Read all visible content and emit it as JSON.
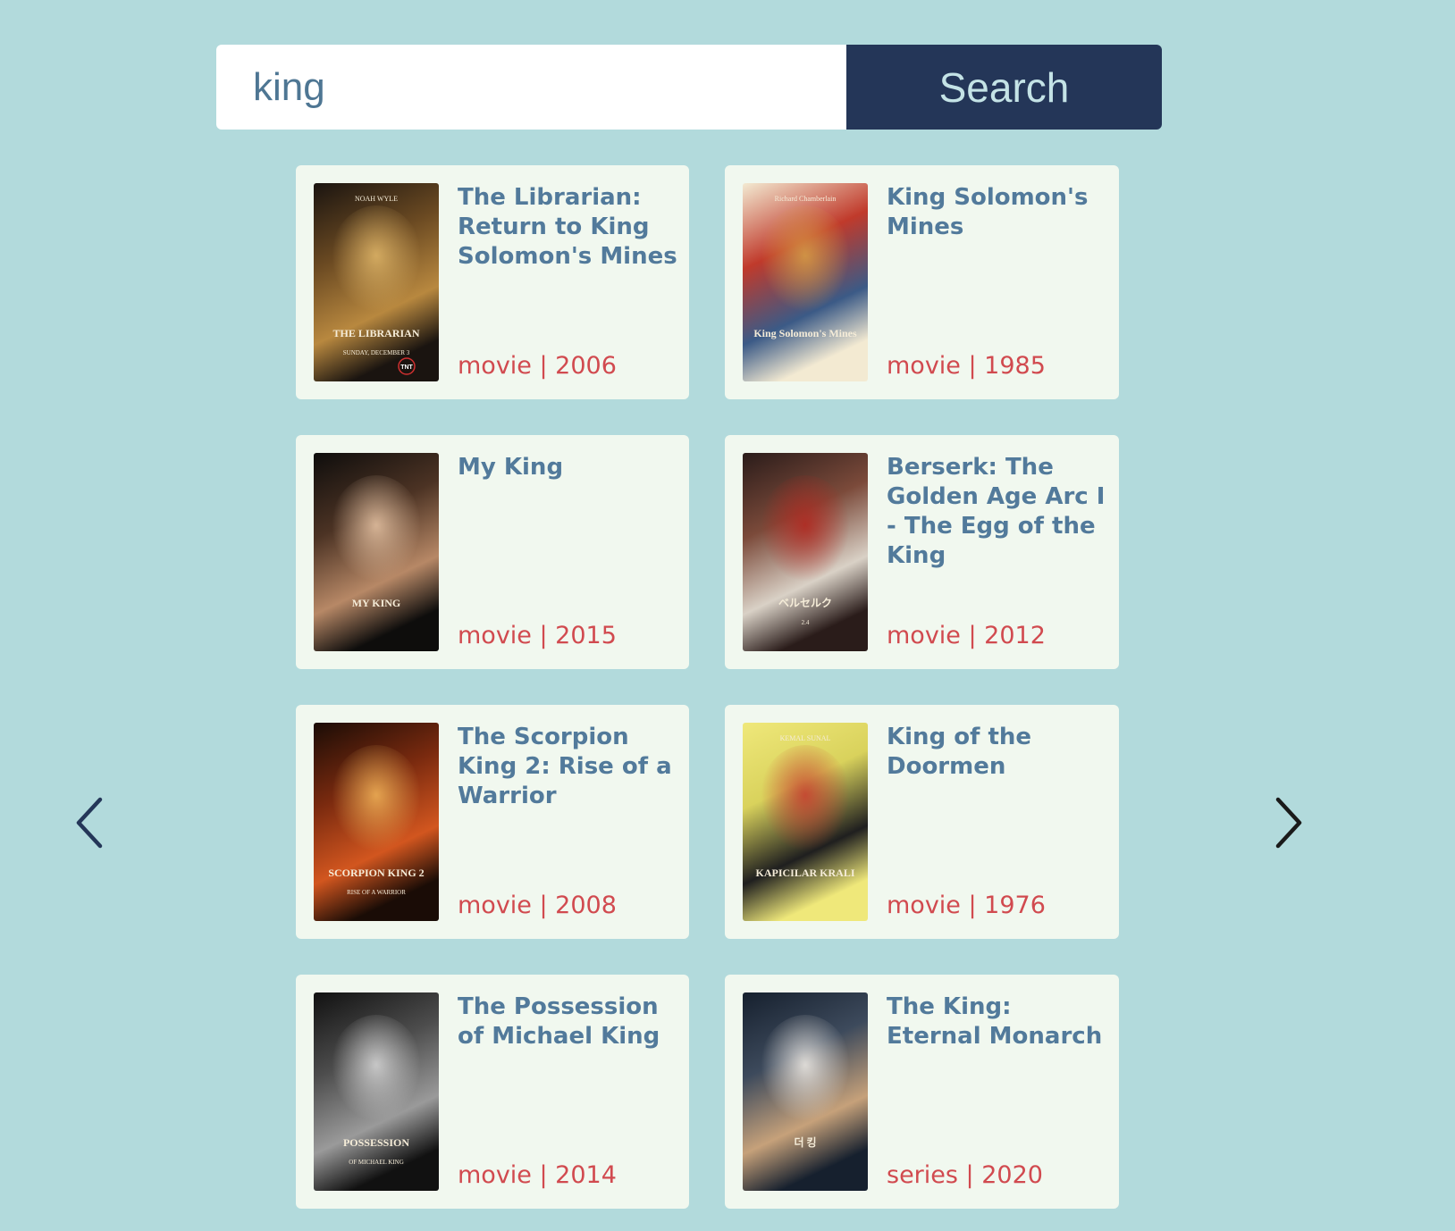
{
  "search": {
    "value": "king",
    "button_label": "Search"
  },
  "results": [
    {
      "title": "The Librarian: Return to King Solomon's Mines",
      "meta": "movie | 2006",
      "poster": {
        "colors": [
          "#1a1410",
          "#6b4a22",
          "#b8883f",
          "#e2b86a"
        ],
        "name_text": "NOAH WYLE",
        "caption": "THE LIBRARIAN",
        "subcaption": "SUNDAY, DECEMBER 3",
        "badge": "TNT"
      }
    },
    {
      "title": "King Solomon's Mines",
      "meta": "movie | 1985",
      "poster": {
        "colors": [
          "#f3ead2",
          "#c03a2b",
          "#3b5a86",
          "#d7a046"
        ],
        "name_text": "Richard Chamberlain",
        "caption": "King Solomon's Mines",
        "subcaption": "",
        "badge": ""
      }
    },
    {
      "title": "My King",
      "meta": "movie | 2015",
      "poster": {
        "colors": [
          "#0e0d0c",
          "#4c3324",
          "#b78866",
          "#e9c6a6"
        ],
        "name_text": "",
        "caption": "MY KING",
        "subcaption": "",
        "badge": ""
      }
    },
    {
      "title": "Berserk: The Golden Age Arc I - The Egg of the King",
      "meta": "movie | 2012",
      "poster": {
        "colors": [
          "#2a1c1a",
          "#7b4a3a",
          "#d9d1c6",
          "#b3261e"
        ],
        "name_text": "",
        "caption": "ベルセルク",
        "subcaption": "2.4",
        "badge": ""
      }
    },
    {
      "title": "The Scorpion King 2: Rise of a Warrior",
      "meta": "movie | 2008",
      "poster": {
        "colors": [
          "#1a0c06",
          "#7a2a0f",
          "#d2561f",
          "#f3b65a"
        ],
        "name_text": "",
        "caption": "SCORPION KING 2",
        "subcaption": "RISE OF A WARRIOR",
        "badge": ""
      }
    },
    {
      "title": "King of the Doormen",
      "meta": "movie | 1976",
      "poster": {
        "colors": [
          "#efe87a",
          "#d9d25c",
          "#1f1f1f",
          "#c73a2e"
        ],
        "name_text": "KEMAL SUNAL",
        "caption": "KAPICILAR KRALI",
        "subcaption": "",
        "badge": ""
      }
    },
    {
      "title": "The Possession of Michael King",
      "meta": "movie | 2014",
      "poster": {
        "colors": [
          "#111111",
          "#4d4d4d",
          "#9a9a9a",
          "#d9d9d9"
        ],
        "name_text": "",
        "caption": "POSSESSION",
        "subcaption": "OF MICHAEL KING",
        "badge": ""
      }
    },
    {
      "title": "The King: Eternal Monarch",
      "meta": "series | 2020",
      "poster": {
        "colors": [
          "#16202e",
          "#3d4a5c",
          "#c6a17a",
          "#f4f0ea"
        ],
        "name_text": "",
        "caption": "더 킹",
        "subcaption": "",
        "badge": ""
      }
    }
  ],
  "pagination": {
    "prev_icon": "chevron-left-icon",
    "next_icon": "chevron-right-icon",
    "prev_color": "#243658",
    "next_color": "#1a1a1a"
  }
}
